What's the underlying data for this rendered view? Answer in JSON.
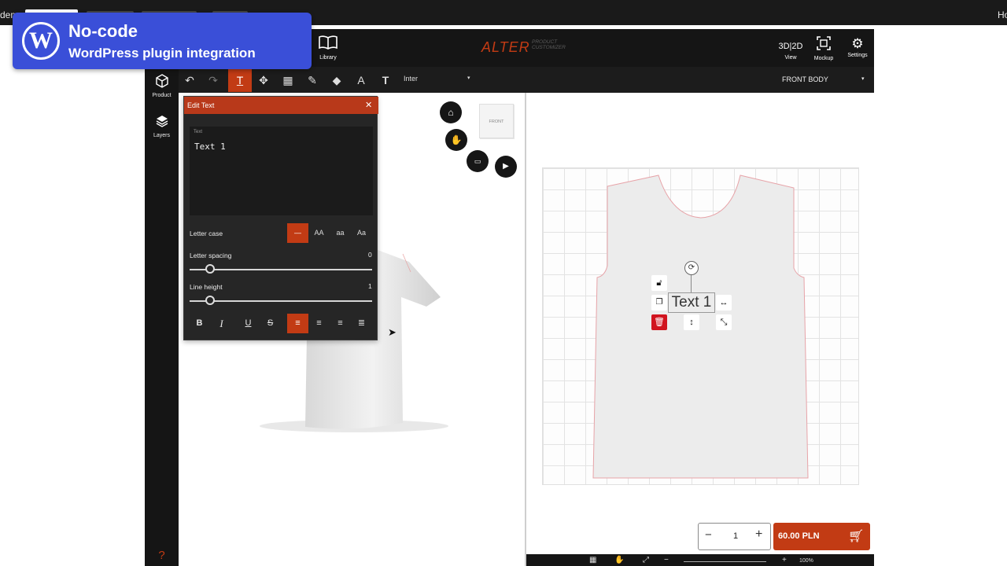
{
  "colors": {
    "accent": "#c23b14",
    "banner": "#3a4fd8",
    "dark": "#151515",
    "delete": "#d1141e"
  },
  "browser": {
    "left_text": "dem",
    "right_text": "Ho"
  },
  "banner": {
    "title": "No-code",
    "subtitle": "WordPress plugin integration",
    "logo_glyph": "W"
  },
  "topbar": {
    "library_label": "Library",
    "brand": "ALTER",
    "brand_sub": "PRODUCT\nCUSTOMIZER",
    "view_glyph": "3D|2D",
    "view_label": "View",
    "mockup_label": "Mockup",
    "settings_label": "Settings"
  },
  "sidebar": {
    "items": [
      {
        "label": "Product",
        "icon": "cube-icon"
      },
      {
        "label": "Layers",
        "icon": "layers-icon"
      }
    ],
    "help": "?"
  },
  "toolbar": {
    "tools": [
      "undo-icon",
      "redo-icon",
      "text-tool-icon",
      "move-icon",
      "grid-icon",
      "pen-icon",
      "fill-icon",
      "font-style-icon",
      "text-format-icon"
    ],
    "active_tool": "text-tool-icon",
    "font": "Inter",
    "part": "FRONT BODY"
  },
  "edit_panel": {
    "title": "Edit Text",
    "text_label": "Text",
    "text_value": "Text 1",
    "letter_case_label": "Letter case",
    "case_options": [
      "—",
      "AA",
      "aa",
      "Aa"
    ],
    "letter_spacing_label": "Letter spacing",
    "letter_spacing_value": "0",
    "line_height_label": "Line height",
    "line_height_value": "1",
    "format_buttons": [
      "B",
      "I",
      "U",
      "S"
    ]
  },
  "view3d": {
    "cube_label": "FRONT"
  },
  "canvas2d": {
    "text_object": "Text 1"
  },
  "cart": {
    "quantity": "1",
    "price": "60.00 PLN"
  },
  "zoom": {
    "level": "100%"
  }
}
